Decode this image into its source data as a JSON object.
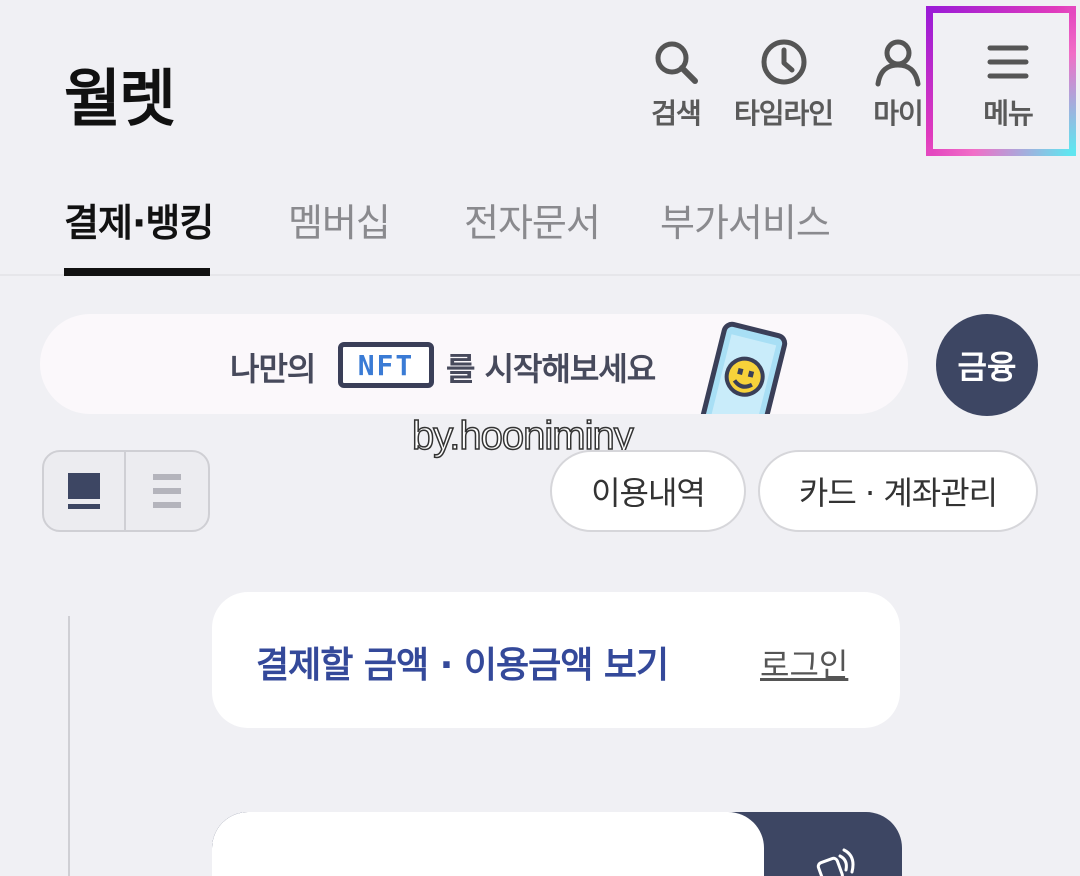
{
  "header": {
    "title": "월렛",
    "buttons": {
      "search": "검색",
      "timeline": "타임라인",
      "my": "마이",
      "menu": "메뉴"
    }
  },
  "tabs": [
    {
      "label": "결제·뱅킹",
      "active": true
    },
    {
      "label": "멤버십",
      "active": false
    },
    {
      "label": "전자문서",
      "active": false
    },
    {
      "label": "부가서비스",
      "active": false
    }
  ],
  "banner": {
    "text_before": "나만의",
    "badge": "NFT",
    "text_after": "를 시작해보세요"
  },
  "finance_button": "금융",
  "watermark": "by.hooniminy",
  "pills": {
    "history": "이용내역",
    "card_account": "카드 · 계좌관리"
  },
  "pay_card": {
    "title": "결제할 금액 · 이용금액 보기",
    "login": "로그인"
  },
  "colors": {
    "background": "#f0f0f4",
    "accent_navy": "#3d4663",
    "card_title": "#34499a",
    "highlight_gradient_start": "#9b1bd6",
    "highlight_gradient_end": "#5fe6f0"
  }
}
